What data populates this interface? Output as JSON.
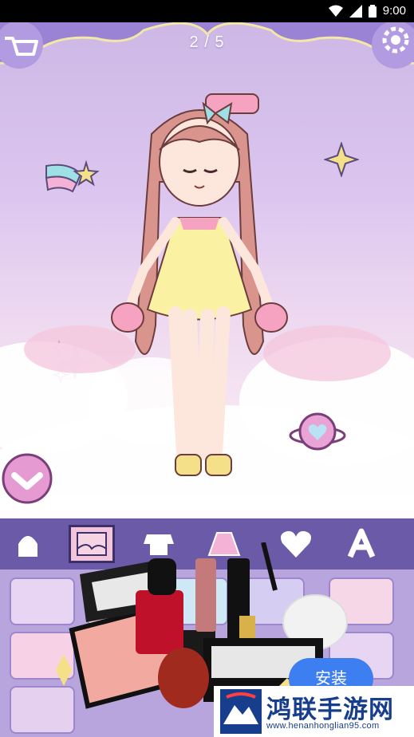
{
  "status_bar": {
    "time": "9:00"
  },
  "game": {
    "page_counter": "2 / 5"
  },
  "ad": {
    "install_label": "安装",
    "brand_name": "鸿联手游网",
    "brand_url": "www.henanhonglian95.com"
  },
  "colors": {
    "toolbar": "#6a5aa8",
    "selected_tool": "#f3c5db",
    "install_button": "#3d7ff0",
    "brand_text": "#173e8c"
  },
  "toolbar_icons": [
    "hair-icon",
    "background-icon",
    "top-icon",
    "bottom-icon",
    "heart-icon",
    "text-icon"
  ]
}
